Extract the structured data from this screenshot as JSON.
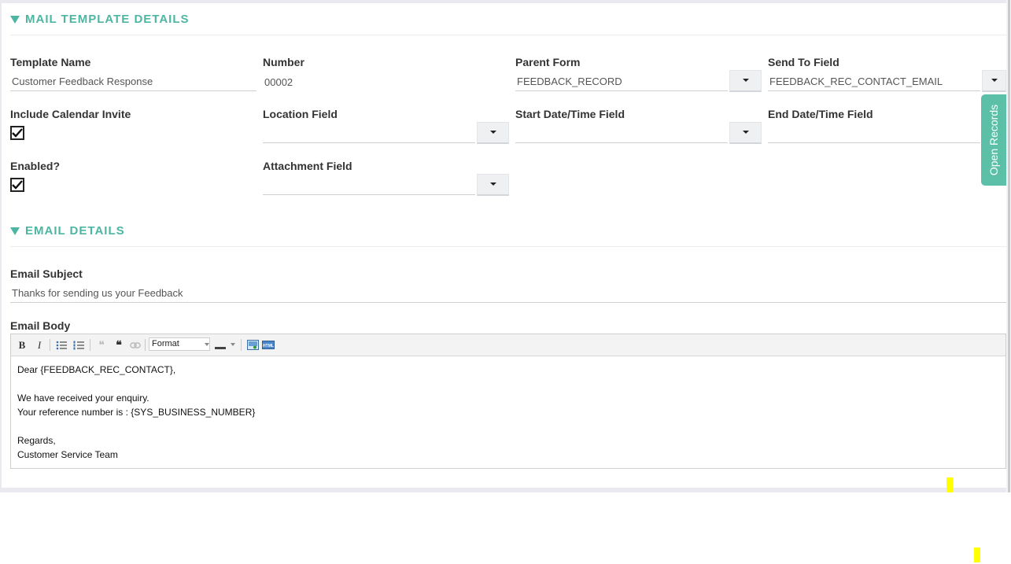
{
  "sections": {
    "mail_template": "MAIL TEMPLATE DETAILS",
    "email_details": "EMAIL DETAILS"
  },
  "fields": {
    "template_name": {
      "label": "Template Name",
      "value": "Customer Feedback Response"
    },
    "number": {
      "label": "Number",
      "value": "00002"
    },
    "parent_form": {
      "label": "Parent Form",
      "value": "FEEDBACK_RECORD"
    },
    "send_to_field": {
      "label": "Send To Field",
      "value": "FEEDBACK_REC_CONTACT_EMAIL"
    },
    "include_calendar_invite": {
      "label": "Include Calendar Invite",
      "checked": true
    },
    "location_field": {
      "label": "Location Field",
      "value": ""
    },
    "start_datetime_field": {
      "label": "Start Date/Time Field",
      "value": ""
    },
    "end_datetime_field": {
      "label": "End Date/Time Field",
      "value": ""
    },
    "enabled": {
      "label": "Enabled?",
      "checked": true
    },
    "attachment_field": {
      "label": "Attachment Field",
      "value": ""
    },
    "email_subject": {
      "label": "Email Subject",
      "value": "Thanks for sending us your Feedback"
    },
    "email_body_label": "Email Body"
  },
  "editor": {
    "format_label": "Format",
    "toolbar_icons": [
      "bold-icon",
      "italic-icon",
      "bulleted-list-icon",
      "numbered-list-icon",
      "unlink-icon",
      "blockquote-icon",
      "link-icon",
      "format-select",
      "text-color-icon",
      "image-icon",
      "html-source-icon"
    ],
    "body_lines": [
      "Dear {FEEDBACK_REC_CONTACT},",
      "",
      "We have received your enquiry.",
      "Your reference number is : {SYS_BUSINESS_NUMBER}",
      "",
      "Regards,",
      "Customer Service Team"
    ]
  },
  "side_tab": {
    "label": "Open Records"
  },
  "colors": {
    "accent": "#4db6a2",
    "side_tab": "#5cbfa8"
  }
}
